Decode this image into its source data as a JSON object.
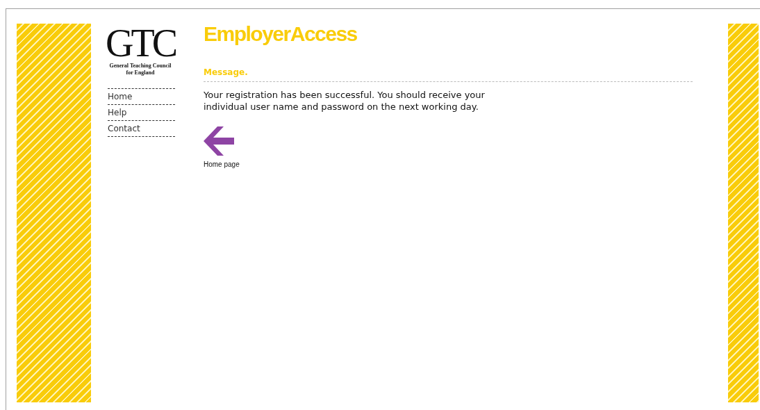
{
  "logo": {
    "letters": "GTC",
    "subtitle_line_1": "General Teaching Council",
    "subtitle_line_2": "for England"
  },
  "nav": [
    {
      "label": "Home"
    },
    {
      "label": "Help"
    },
    {
      "label": "Contact"
    }
  ],
  "header": {
    "title": "EmployerAccess"
  },
  "message": {
    "heading": "Message.",
    "text": "Your registration has been successful. You should receive your individual user name and password on the next working day."
  },
  "back_link": {
    "label": "Home page"
  }
}
